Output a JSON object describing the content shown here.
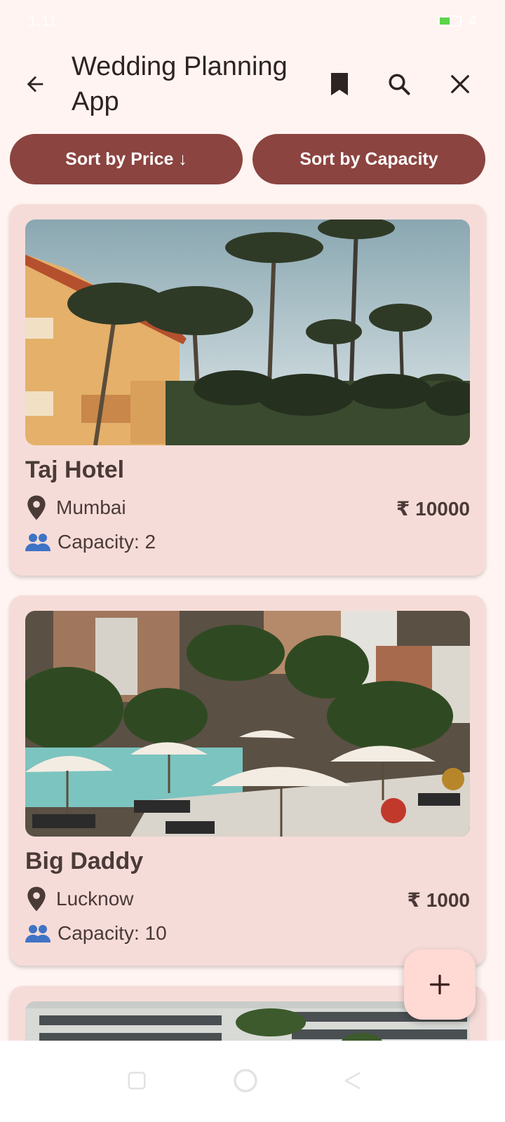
{
  "status_bar": {
    "time": "1:11",
    "battery": "4"
  },
  "app_bar": {
    "title": "Wedding Planning App"
  },
  "sort": {
    "price_label": "Sort by Price ↓",
    "capacity_label": "Sort by Capacity"
  },
  "venues": [
    {
      "name": "Taj Hotel",
      "location": "Mumbai",
      "price": "₹ 10000",
      "capacity": "Capacity: 2"
    },
    {
      "name": "Big Daddy",
      "location": "Lucknow",
      "price": "₹ 1000",
      "capacity": "Capacity: 10"
    }
  ],
  "colors": {
    "background": "#fff4f1",
    "card": "#f6dcd8",
    "button": "#8b4440",
    "fab": "#ffd9d3",
    "people_icon": "#3f73c6"
  },
  "icons": {
    "back": "arrow-back-icon",
    "bookmark": "bookmark-icon",
    "search": "search-icon",
    "close": "close-icon",
    "location": "location-pin-icon",
    "people": "people-icon",
    "add": "plus-icon"
  }
}
